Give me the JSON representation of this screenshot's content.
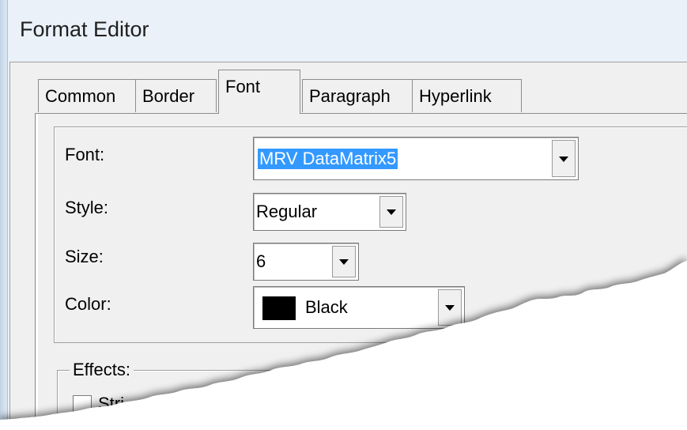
{
  "window": {
    "title": "Format Editor"
  },
  "tabs": [
    {
      "label": "Common"
    },
    {
      "label": "Border"
    },
    {
      "label": "Font"
    },
    {
      "label": "Paragraph"
    },
    {
      "label": "Hyperlink"
    }
  ],
  "font_tab": {
    "font_label": "Font:",
    "font_value": "MRV DataMatrix5",
    "style_label": "Style:",
    "style_value": "Regular",
    "size_label": "Size:",
    "size_value": "6",
    "color_label": "Color:",
    "color_value": "Black",
    "color_swatch": "#000000"
  },
  "effects": {
    "label": "Effects:",
    "first_checkbox_label_partial": "Stri"
  },
  "icons": [
    "chevron-down-icon",
    "checkbox-icon",
    "color-swatch"
  ],
  "colors": {
    "selection": "#3399ff",
    "dialog_bg": "#f0f0f0",
    "title_bar": "#eaf1f9"
  }
}
